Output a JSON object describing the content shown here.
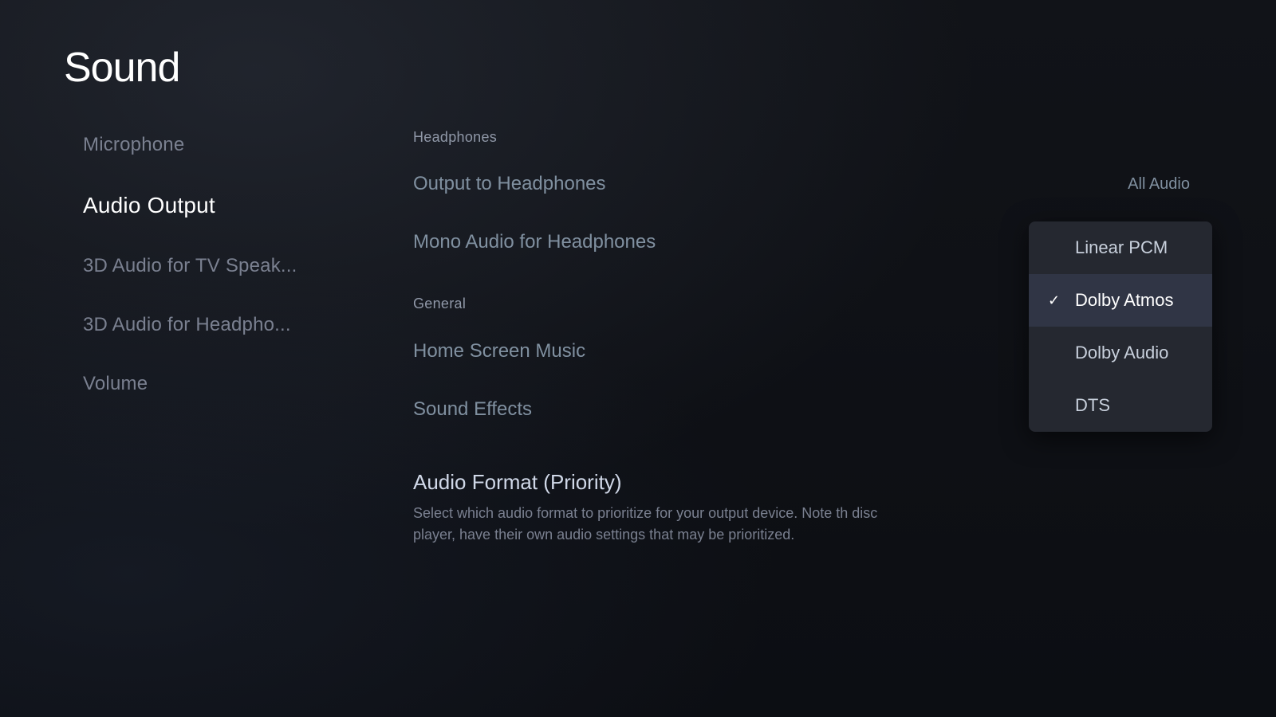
{
  "page": {
    "title": "Sound"
  },
  "sidebar": {
    "items": [
      {
        "id": "microphone",
        "label": "Microphone",
        "active": false
      },
      {
        "id": "audio-output",
        "label": "Audio Output",
        "active": true
      },
      {
        "id": "3d-audio-tv",
        "label": "3D Audio for TV Speak...",
        "active": false
      },
      {
        "id": "3d-audio-headphones",
        "label": "3D Audio for Headpho...",
        "active": false
      },
      {
        "id": "volume",
        "label": "Volume",
        "active": false
      }
    ]
  },
  "main": {
    "sections": [
      {
        "id": "headphones",
        "label": "Headphones",
        "items": [
          {
            "id": "output-to-headphones",
            "label": "Output to Headphones",
            "value": "All Audio",
            "type": "value"
          },
          {
            "id": "mono-audio",
            "label": "Mono Audio for Headphones",
            "type": "toggle-circle"
          }
        ]
      },
      {
        "id": "general",
        "label": "General",
        "items": [
          {
            "id": "home-screen-music",
            "label": "Home Screen Music",
            "type": "toggle",
            "enabled": false
          },
          {
            "id": "sound-effects",
            "label": "Sound Effects",
            "type": "plain"
          }
        ]
      }
    ],
    "audio_format": {
      "id": "audio-format-priority",
      "title": "Audio Format (Priority)",
      "description": "Select which audio format to prioritize for your output device. Note th disc player, have their own audio settings that may be prioritized."
    },
    "dropdown": {
      "items": [
        {
          "id": "linear-pcm",
          "label": "Linear PCM",
          "selected": false
        },
        {
          "id": "dolby-atmos",
          "label": "Dolby Atmos",
          "selected": true
        },
        {
          "id": "dolby-audio",
          "label": "Dolby Audio",
          "selected": false
        },
        {
          "id": "dts",
          "label": "DTS",
          "selected": false
        }
      ]
    }
  },
  "icons": {
    "check": "✓"
  }
}
